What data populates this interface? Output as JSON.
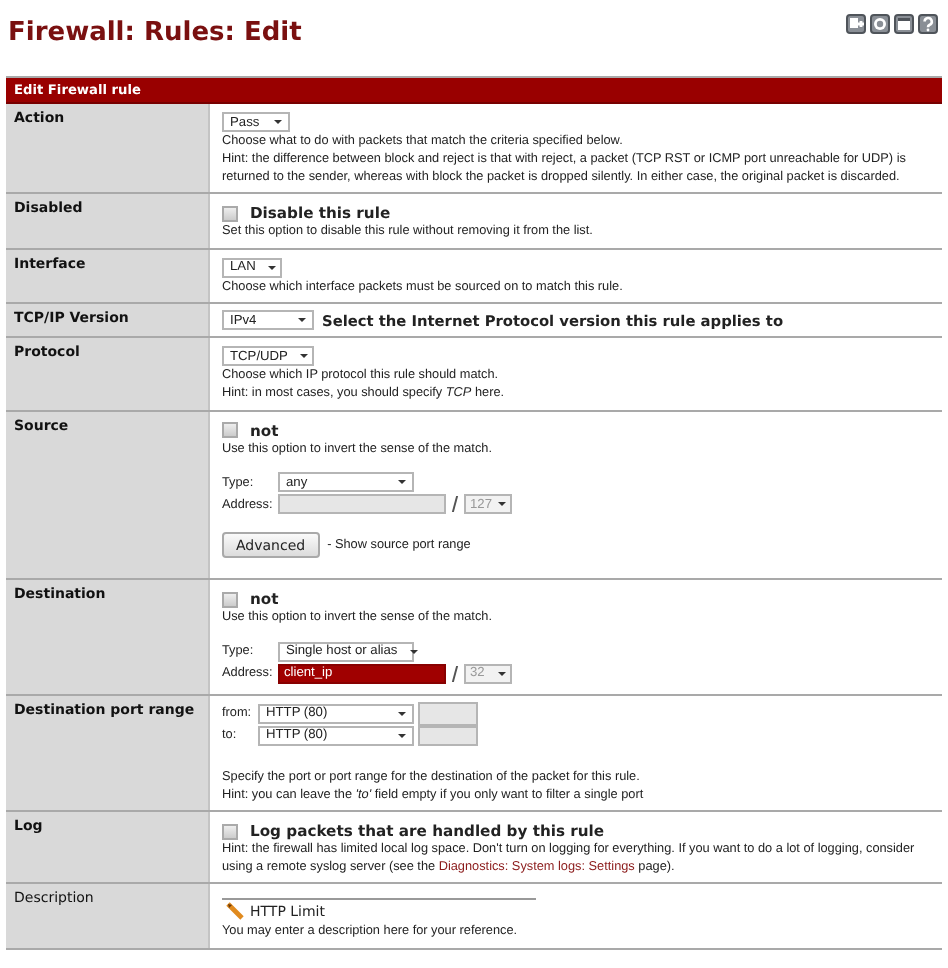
{
  "page_title": "Firewall: Rules: Edit",
  "panel_title": "Edit Firewall rule",
  "rows": [
    {
      "kind": "select",
      "label": "Action",
      "label_bold": true,
      "value": "Pass",
      "help": [
        "Choose what to do with packets that match the criteria specified below.",
        "Hint: the difference between block and reject is that with reject, a packet (TCP RST or ICMP port unreachable for UDP) is returned to the sender, whereas with block the packet is dropped silently. In either case, the original packet is discarded."
      ]
    },
    {
      "kind": "checkbox",
      "label": "Disabled",
      "label_bold": true,
      "checked": false,
      "text": "Disable this rule",
      "help": [
        "Set this option to disable this rule without removing it from the list."
      ]
    },
    {
      "kind": "select",
      "label": "Interface",
      "label_bold": true,
      "value": "LAN",
      "help": [
        "Choose which interface packets must be sourced on to match this rule."
      ]
    },
    {
      "kind": "select",
      "label": "TCP/IP Version",
      "label_bold": true,
      "value": "IPv4",
      "note": "Select the Internet Protocol version this rule applies to"
    },
    {
      "kind": "select",
      "label": "Protocol",
      "label_bold": true,
      "value": "TCP/UDP",
      "help": [
        "Choose which IP protocol this rule should match.",
        "Hint: in most cases, you should specify *TCP* here."
      ]
    },
    {
      "kind": "address",
      "label": "Source",
      "label_bold": true,
      "not_checked": false,
      "not_text": "not",
      "help": [
        "Use this option to invert the sense of the match."
      ],
      "type_label": "Type:",
      "type_value": "any",
      "address_label": "Address:",
      "address": {
        "disabled": true,
        "invalid": false
      },
      "mask": {
        "value": "127",
        "disabled": true
      },
      "button": "Advanced",
      "button_note": "- Show source port range"
    },
    {
      "kind": "address",
      "label": "Destination",
      "label_bold": true,
      "not_checked": false,
      "not_text": "not",
      "help": [
        "Use this option to invert the sense of the match."
      ],
      "type_label": "Type:",
      "type_value": "Single host or alias",
      "address_label": "Address:",
      "address": {
        "value": "client_ip",
        "disabled": false,
        "invalid": true
      },
      "mask": {
        "value": "32",
        "disabled": true
      }
    },
    {
      "kind": "port_range",
      "label": "Destination port range",
      "label_bold": true,
      "ports": [
        {
          "label": "from:",
          "value": "HTTP (80)",
          "custom_disabled": true
        },
        {
          "label": "to:",
          "value": "HTTP (80)",
          "custom_disabled": true
        }
      ],
      "help": [
        "Specify the port or port range for the destination of the packet for this rule.",
        "Hint: you can leave the *'to'* field empty if you only want to filter a single port"
      ]
    },
    {
      "kind": "checkbox",
      "label": "Log",
      "label_bold": true,
      "checked": false,
      "text": "Log packets that are handled by this rule",
      "help": [
        {
          "parts": [
            {
              "kind": "text",
              "text": "Hint: the firewall has limited local log space. Don't turn on logging for everything. If you want to do a lot of logging, consider using a remote syslog server (see the "
            },
            {
              "kind": "link",
              "text": "Diagnostics: System logs: Settings"
            },
            {
              "kind": "text",
              "text": " page)."
            }
          ]
        }
      ]
    },
    {
      "kind": "text",
      "label": "Description",
      "label_bold": false,
      "value": "HTTP Limit",
      "help": [
        "You may enter a description here for your reference."
      ]
    }
  ]
}
